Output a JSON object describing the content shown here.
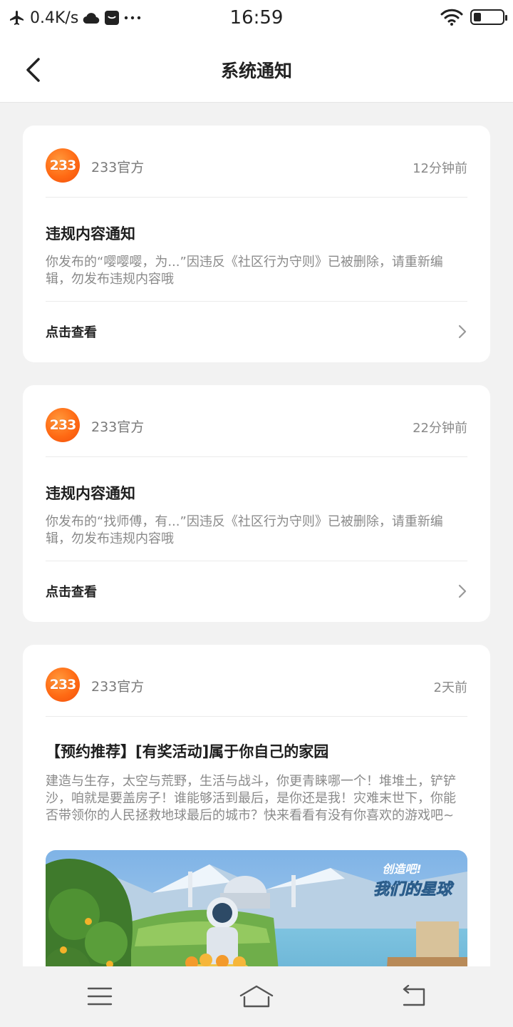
{
  "status_bar": {
    "network_speed": "0.4K/s",
    "time": "16:59",
    "battery_level": 0.25
  },
  "nav": {
    "title": "系统通知"
  },
  "notifications": [
    {
      "logo_text": "233",
      "sender": "233官方",
      "time": "12分钟前",
      "title": "违规内容通知",
      "body": "你发布的“嘤嘤嘤，为...”因违反《社区行为守则》已被删除，请重新编辑，勿发布违规内容哦",
      "action_label": "点击查看"
    },
    {
      "logo_text": "233",
      "sender": "233官方",
      "time": "22分钟前",
      "title": "违规内容通知",
      "body": "你发布的“找师傅，有...”因违反《社区行为守则》已被删除，请重新编辑，勿发布违规内容哦",
      "action_label": "点击查看"
    },
    {
      "logo_text": "233",
      "sender": "233官方",
      "time": "2天前",
      "title": "【预约推荐】[有奖活动]属于你自己的家园",
      "body": "建造与生存，太空与荒野，生活与战斗，你更青睐哪一个！堆堆土，铲铲沙，咱就是要盖房子！谁能够活到最后，是你还是我！灾难末世下，你能否带领你的人民拯救地球最后的城市？快来看看有没有你喜欢的游戏吧~",
      "banner_text_1": "创造吧!",
      "banner_text_2": "我们的星球"
    }
  ],
  "icons": {
    "back": "chevron-left-icon",
    "chevron": "chevron-right-icon",
    "menu": "menu-icon",
    "home": "home-icon",
    "return": "return-icon"
  }
}
